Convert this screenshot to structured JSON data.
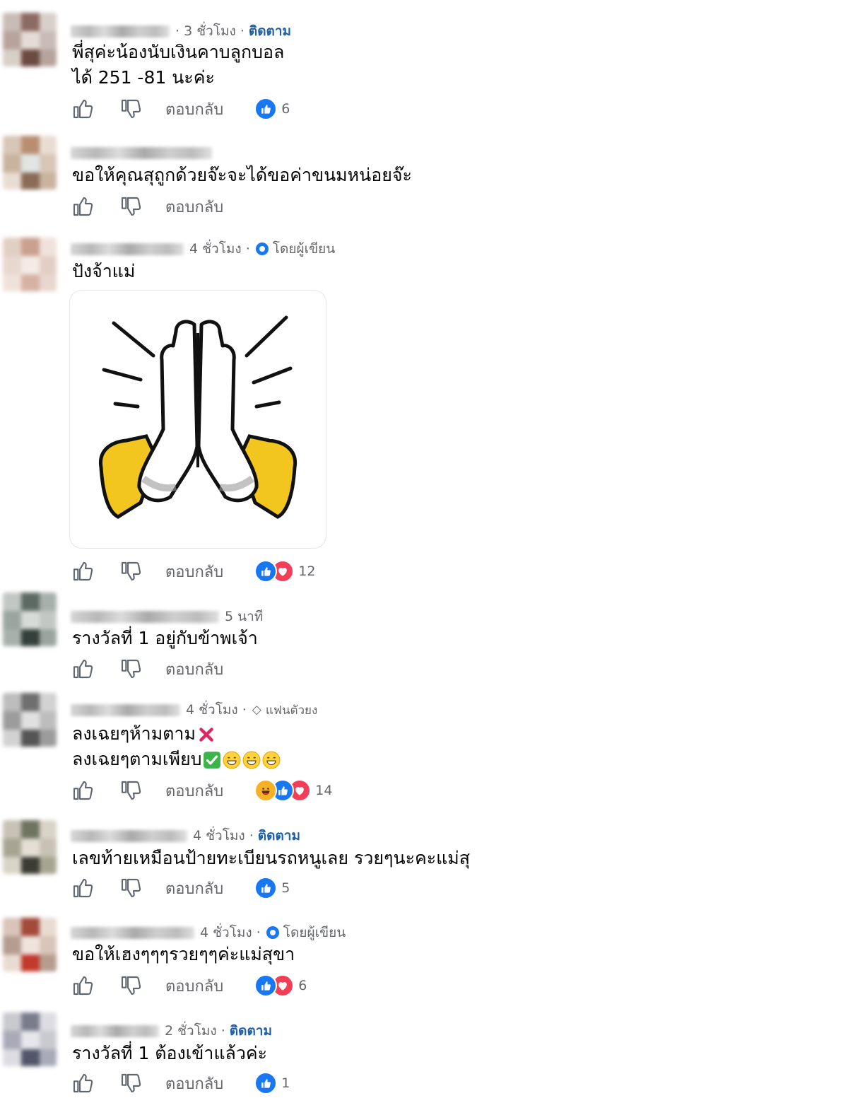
{
  "reply_label": "ตอบกลับ",
  "colors": {
    "like": "#1877f2",
    "love": "#f33e58",
    "haha": "#f7b125",
    "follow": "#1d5fa8"
  },
  "comments": [
    {
      "time": "· 3 ชั่วโมง ·",
      "badge": "ติดตาม",
      "lines": [
        "พี่สุค่ะน้องนับเงินคาบลูกบอล",
        "ได้ 251 -81 นะค่ะ"
      ],
      "reaction_count": "6",
      "reactions": [
        "like"
      ]
    },
    {
      "time": "",
      "badge": "",
      "lines": [
        "ขอให้คุณสุถูกด้วยจ๊ะจะได้ขอค่าขนมหน่อยจ๊ะ"
      ],
      "reaction_count": "",
      "reactions": []
    },
    {
      "time": "4 ชั่วโมง ·",
      "badge": "โดยผู้เขียน",
      "lines": [
        "ปังจ้าแม่"
      ],
      "sticker": "praying-hands",
      "reaction_count": "12",
      "reactions": [
        "like",
        "love"
      ]
    },
    {
      "time": "5 นาที",
      "badge": "",
      "lines": [
        "รางวัลที่ 1 อยู่กับข้าพเจ้า"
      ],
      "reaction_count": "",
      "reactions": []
    },
    {
      "time": "4 ชั่วโมง ·",
      "badge": "แฟนตัวยง",
      "lines": [
        "ลงเฉยๆห้ามตาม",
        "ลงเฉยๆตามเพียบ"
      ],
      "reaction_count": "14",
      "reactions": [
        "haha",
        "like",
        "love"
      ]
    },
    {
      "time": "4 ชั่วโมง ·",
      "badge": "ติดตาม",
      "lines": [
        "เลขท้ายเหมือนป้ายทะเบียนรถหนูเลย รวยๆนะคะแม่สุ"
      ],
      "reaction_count": "5",
      "reactions": [
        "like"
      ]
    },
    {
      "time": "4 ชั่วโมง ·",
      "badge": "โดยผู้เขียน",
      "lines": [
        "ขอให้เฮงๆๆๆรวยๆๆค่ะแม่สุขา"
      ],
      "reaction_count": "6",
      "reactions": [
        "like",
        "love"
      ]
    },
    {
      "time": "2 ชั่วโมง ·",
      "badge": "ติดตาม",
      "lines": [
        "รางวัลที่ 1 ต้องเข้าแล้วค่ะ"
      ],
      "reaction_count": "1",
      "reactions": [
        "like"
      ]
    }
  ]
}
